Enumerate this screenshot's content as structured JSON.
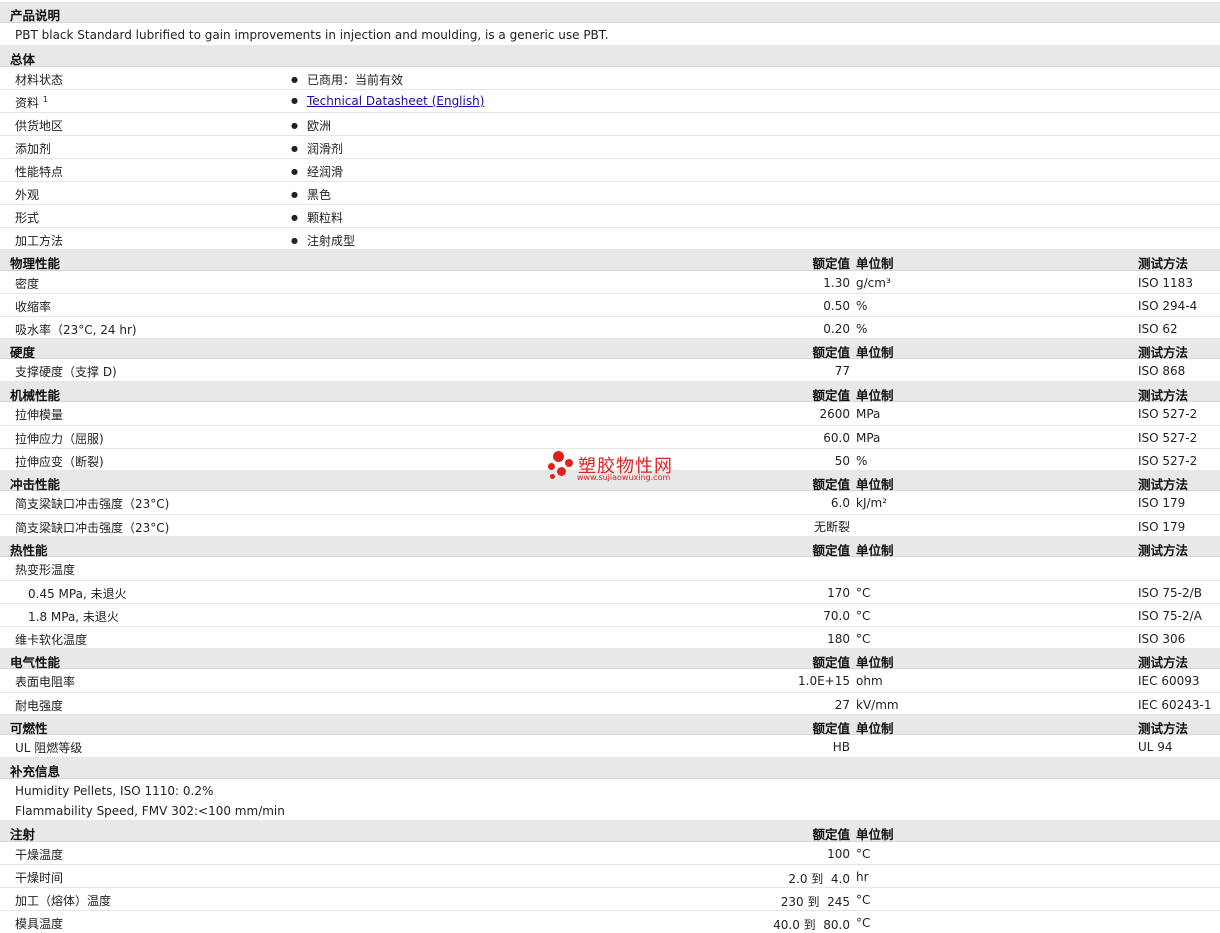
{
  "description": {
    "title": "产品说明",
    "text": "PBT black Standard lubrified to gain improvements in injection and moulding, is a generic use PBT."
  },
  "general": {
    "title": "总体",
    "items": [
      {
        "label": "材料状态",
        "value": "已商用：当前有效"
      },
      {
        "label": "资料",
        "sup": "1",
        "value": "Technical Datasheet (English)"
      },
      {
        "label": "供货地区",
        "value": "欧洲"
      },
      {
        "label": "添加剂",
        "value": "润滑剂"
      },
      {
        "label": "性能特点",
        "value": "经润滑"
      },
      {
        "label": "外观",
        "value": "黑色"
      },
      {
        "label": "形式",
        "value": "颗粒料"
      },
      {
        "label": "加工方法",
        "value": "注射成型"
      }
    ]
  },
  "col_headers": {
    "nominal": "额定值",
    "unit": "单位制",
    "test": "测试方法"
  },
  "physical": {
    "title": "物理性能",
    "rows": [
      {
        "label": "密度",
        "value": "1.30",
        "unit": "g/cm³",
        "test": "ISO 1183"
      },
      {
        "label": "收缩率",
        "value": "0.50",
        "unit": "%",
        "test": "ISO 294-4"
      },
      {
        "label": "吸水率（23°C, 24 hr)",
        "value": "0.20",
        "unit": "%",
        "test": "ISO 62"
      }
    ]
  },
  "hardness": {
    "title": "硬度",
    "rows": [
      {
        "label": "支撑硬度（支撑 D)",
        "value": "77",
        "unit": "",
        "test": "ISO 868"
      }
    ]
  },
  "mechanical": {
    "title": "机械性能",
    "rows": [
      {
        "label": "拉伸模量",
        "value": "2600",
        "unit": "MPa",
        "test": "ISO 527-2"
      },
      {
        "label": "拉伸应力（屈服)",
        "value": "60.0",
        "unit": "MPa",
        "test": "ISO 527-2"
      },
      {
        "label": "拉伸应变（断裂)",
        "value": "50",
        "unit": "%",
        "test": "ISO 527-2"
      }
    ]
  },
  "impact": {
    "title": "冲击性能",
    "rows": [
      {
        "label": "简支梁缺口冲击强度（23°C)",
        "value": "6.0",
        "unit": "kJ/m²",
        "test": "ISO 179"
      },
      {
        "label": "简支梁缺口冲击强度（23°C)",
        "value": "无断裂",
        "unit": "",
        "test": "ISO 179"
      }
    ]
  },
  "thermal": {
    "title": "热性能",
    "group_label": "热变形温度",
    "rows": [
      {
        "label": "0.45 MPa, 未退火",
        "value": "170",
        "unit": "°C",
        "test": "ISO 75-2/B"
      },
      {
        "label": "1.8 MPa, 未退火",
        "value": "70.0",
        "unit": "°C",
        "test": "ISO 75-2/A"
      }
    ],
    "vicat": {
      "label": "维卡软化温度",
      "value": "180",
      "unit": "°C",
      "test": "ISO 306"
    }
  },
  "electrical": {
    "title": "电气性能",
    "rows": [
      {
        "label": "表面电阻率",
        "value": "1.0E+15",
        "unit": "ohm",
        "test": "IEC 60093"
      },
      {
        "label": "耐电强度",
        "value": "27",
        "unit": "kV/mm",
        "test": "IEC 60243-1"
      }
    ]
  },
  "flammability": {
    "title": "可燃性",
    "rows": [
      {
        "label": "UL 阻燃等级",
        "value": "HB",
        "unit": "",
        "test": "UL 94"
      }
    ]
  },
  "supplementary": {
    "title": "补充信息",
    "lines": [
      "Humidity Pellets, ISO 1110: 0.2%",
      "Flammability Speed, FMV 302:<100 mm/min"
    ]
  },
  "injection": {
    "title": "注射",
    "rows": [
      {
        "label": "干燥温度",
        "value": "100",
        "unit": "°C"
      },
      {
        "label": "干燥时间",
        "value": "2.0 到  4.0",
        "unit": "hr"
      },
      {
        "label": "加工（熔体）温度",
        "value": "230 到  245",
        "unit": "°C"
      },
      {
        "label": "模具温度",
        "value": "40.0 到  80.0",
        "unit": "°C"
      }
    ]
  },
  "watermark": {
    "name": "塑胶物性网",
    "url": "www.sujiaowuxing.com",
    "color": "#e02020"
  }
}
